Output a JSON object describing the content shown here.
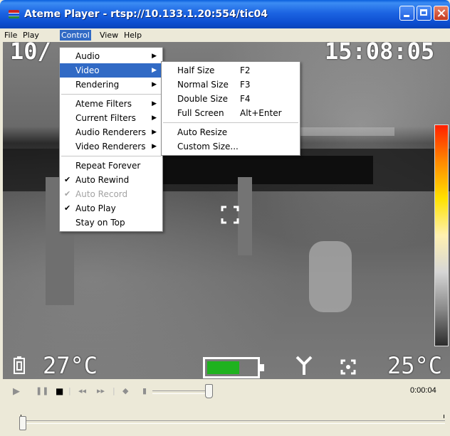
{
  "window": {
    "title": "Ateme Player - rtsp://10.133.1.20:554/tic04"
  },
  "menubar": {
    "items": [
      "File",
      "Play",
      "Control",
      "View",
      "Help"
    ]
  },
  "control_menu": {
    "items": [
      {
        "label": "Audio",
        "submenu": true
      },
      {
        "label": "Video",
        "submenu": true,
        "active": true
      },
      {
        "label": "Rendering",
        "submenu": true
      },
      {
        "label": "Ateme Filters",
        "submenu": true
      },
      {
        "label": "Current Filters",
        "submenu": true
      },
      {
        "label": "Audio Renderers",
        "submenu": true
      },
      {
        "label": "Video Renderers",
        "submenu": true
      },
      {
        "label": "Repeat Forever",
        "checked": false
      },
      {
        "label": "Auto Rewind",
        "checked": true
      },
      {
        "label": "Auto Record",
        "checked": true,
        "disabled": true
      },
      {
        "label": "Auto Play",
        "checked": true
      },
      {
        "label": "Stay on Top",
        "checked": false
      }
    ]
  },
  "video_menu": {
    "items": [
      {
        "label": "Half Size",
        "shortcut": "F2"
      },
      {
        "label": "Normal Size",
        "shortcut": "F3"
      },
      {
        "label": "Double Size",
        "shortcut": "F4"
      },
      {
        "label": "Full Screen",
        "shortcut": "Alt+Enter"
      },
      {
        "label": "Auto Resize",
        "shortcut": ""
      },
      {
        "label": "Custom Size...",
        "shortcut": ""
      }
    ]
  },
  "osd": {
    "date_partial": "10/",
    "time": "15:08:05",
    "temp_left": "27°C",
    "temp_right": "25°C",
    "battery_level_pct": 65
  },
  "playback": {
    "elapsed": "0:00:04"
  },
  "colors": {
    "menu_highlight": "#316ac5",
    "battery_fill": "#1fb21f"
  }
}
